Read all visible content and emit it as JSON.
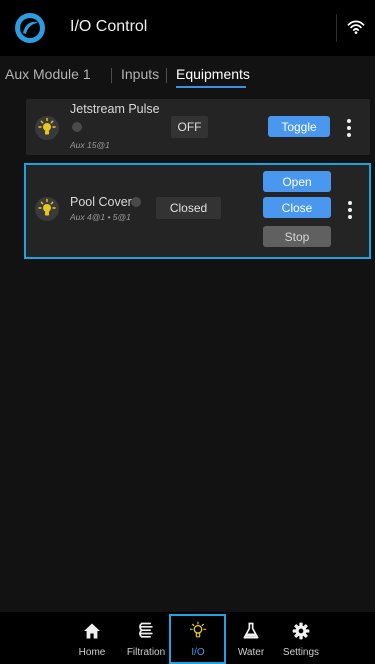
{
  "header": {
    "title": "I/O Control",
    "logo_icon": "app-logo-icon",
    "wifi_icon": "wifi-icon"
  },
  "tabs": [
    {
      "label": "Aux Module 1",
      "active": false
    },
    {
      "label": "Inputs",
      "active": false
    },
    {
      "label": "Equipments",
      "active": true
    }
  ],
  "equipments": [
    {
      "name": "Jetstream Pulse",
      "address": "Aux 15@1",
      "state": "OFF",
      "buttons": [
        "Toggle"
      ],
      "icon": "lightbulb-icon"
    },
    {
      "name": "Pool Cover",
      "address": "Aux 4@1 • 5@1",
      "state": "Closed",
      "buttons": [
        "Open",
        "Close",
        "Stop"
      ],
      "icon": "lightbulb-icon"
    }
  ],
  "nav": [
    {
      "label": "Home",
      "icon": "home-icon",
      "active": false
    },
    {
      "label": "Filtration",
      "icon": "filtration-icon",
      "active": false
    },
    {
      "label": "I/O",
      "icon": "lightbulb-icon",
      "active": true
    },
    {
      "label": "Water",
      "icon": "flask-icon",
      "active": false
    },
    {
      "label": "Settings",
      "icon": "gear-icon",
      "active": false
    }
  ],
  "colors": {
    "accent": "#4a97f0",
    "highlight": "#1fa3e0",
    "bulb": "#e8c71f",
    "background": "#121212"
  }
}
